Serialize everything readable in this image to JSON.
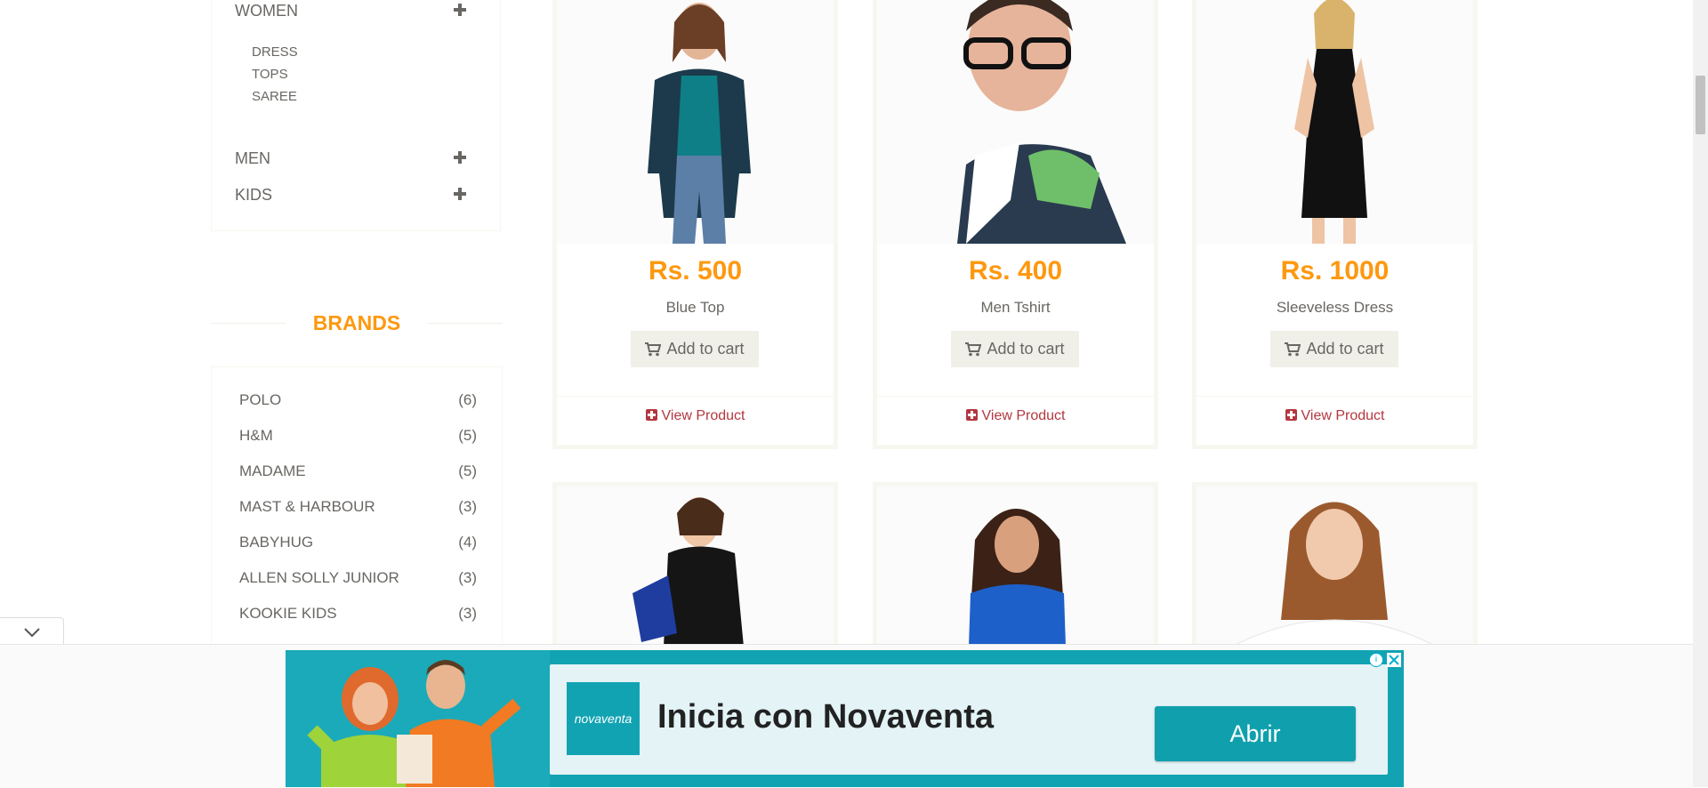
{
  "sidebar": {
    "categories": [
      {
        "label": "WOMEN",
        "subcategories": [
          "DRESS",
          "TOPS",
          "SAREE"
        ]
      },
      {
        "label": "MEN"
      },
      {
        "label": "KIDS"
      }
    ],
    "brands_title": "BRANDS",
    "brands": [
      {
        "name": "POLO",
        "count": "(6)"
      },
      {
        "name": "H&M",
        "count": "(5)"
      },
      {
        "name": "MADAME",
        "count": "(5)"
      },
      {
        "name": "MAST & HARBOUR",
        "count": "(3)"
      },
      {
        "name": "BABYHUG",
        "count": "(4)"
      },
      {
        "name": "ALLEN SOLLY JUNIOR",
        "count": "(3)"
      },
      {
        "name": "KOOKIE KIDS",
        "count": "(3)"
      }
    ]
  },
  "products": [
    {
      "price": "Rs. 500",
      "name": "Blue Top",
      "add_to_cart": "Add to cart",
      "view": "View Product"
    },
    {
      "price": "Rs. 400",
      "name": "Men Tshirt",
      "add_to_cart": "Add to cart",
      "view": "View Product"
    },
    {
      "price": "Rs. 1000",
      "name": "Sleeveless Dress",
      "add_to_cart": "Add to cart",
      "view": "View Product"
    }
  ],
  "ad": {
    "logo_text": "novaventa",
    "headline": "Inicia con Novaventa",
    "cta": "Abrir",
    "info_icon": "i"
  },
  "colors": {
    "accent": "#fe980f",
    "view_link": "#b3373f",
    "ad_bg": "#12a3b3"
  }
}
